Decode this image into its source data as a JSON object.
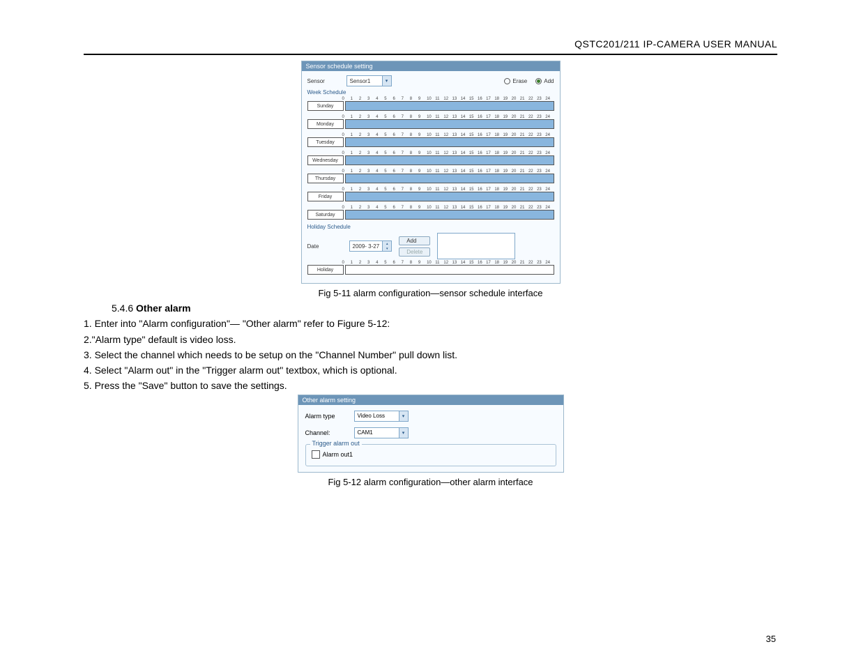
{
  "header": "QSTC201/211 IP-CAMERA USER MANUAL",
  "page_number": "35",
  "fig1": {
    "panel_title": "Sensor schedule setting",
    "sensor_label": "Sensor",
    "sensor_value": "Sensor1",
    "erase_label": "Erase",
    "add_label": "Add",
    "week_heading": "Week Schedule",
    "hours": [
      "0",
      "1",
      "2",
      "3",
      "4",
      "5",
      "6",
      "7",
      "8",
      "9",
      "10",
      "11",
      "12",
      "13",
      "14",
      "15",
      "16",
      "17",
      "18",
      "19",
      "20",
      "21",
      "22",
      "23",
      "24"
    ],
    "days": [
      "Sunday",
      "Monday",
      "Tuesday",
      "Wednesday",
      "Thursday",
      "Friday",
      "Saturday"
    ],
    "holiday_heading": "Holiday Schedule",
    "date_label": "Date",
    "date_value": "2009- 3-27",
    "add_btn": "Add",
    "delete_btn": "Delete",
    "holiday_day": "Holiday",
    "caption": "Fig 5-11 alarm configuration—sensor schedule interface"
  },
  "section": {
    "num": "5.4.6",
    "title": "Other alarm",
    "line1": "1. Enter into \"Alarm configuration\"— \"Other alarm\" refer to Figure 5-12:",
    "line2": "2.\"Alarm type\" default is video loss.",
    "line3": "3. Select the channel which needs to be setup on the \"Channel Number\" pull down list.",
    "line4": "4. Select \"Alarm out\" in the \"Trigger alarm out\" textbox, which is optional.",
    "line5": "5. Press the \"Save\" button to save the settings."
  },
  "fig2": {
    "panel_title": "Other alarm setting",
    "alarm_type_label": "Alarm type",
    "alarm_type_value": "Video Loss",
    "channel_label": "Channel:",
    "channel_value": "CAM1",
    "trigger_legend": "Trigger alarm out",
    "alarm_out_label": "Alarm out1",
    "caption": "Fig 5-12 alarm configuration—other alarm interface"
  }
}
